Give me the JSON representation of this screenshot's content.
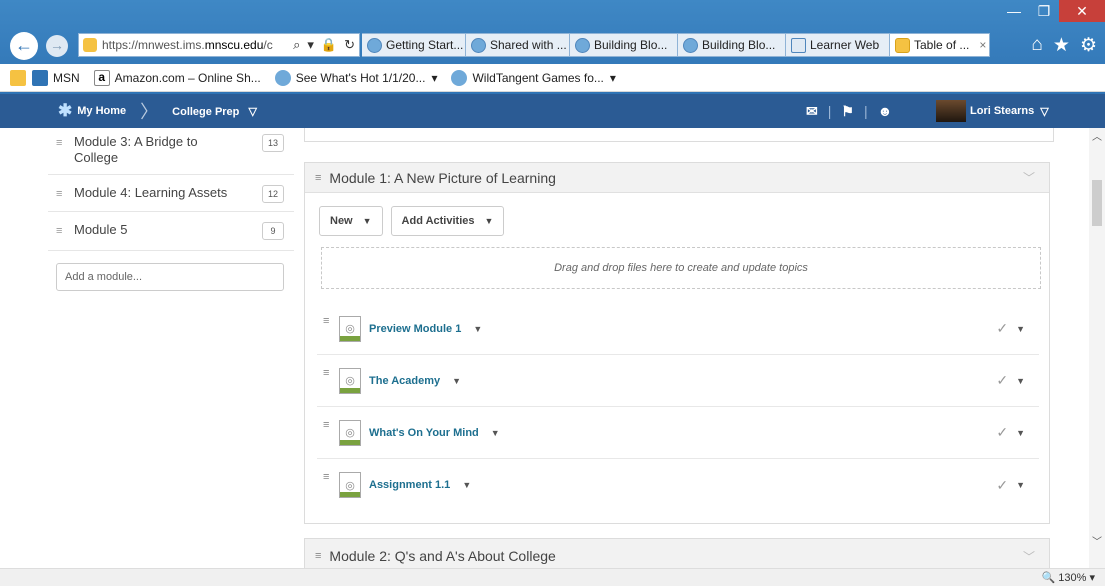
{
  "window_controls": {
    "minimize": "—",
    "restore": "❐",
    "close": "✕"
  },
  "browser": {
    "back_icon": "←",
    "forward_icon": "→",
    "url_prefix": "https://mnwest.ims.",
    "url_domain": "mnscu.edu",
    "url_suffix": "/c",
    "addr_tools": [
      "⌕",
      "▾",
      "🔒",
      "↻"
    ],
    "tabs": [
      {
        "label": "Getting Start...",
        "active": false
      },
      {
        "label": "Shared with ...",
        "active": false
      },
      {
        "label": "Building Blo...",
        "active": false
      },
      {
        "label": "Building Blo...",
        "active": false
      },
      {
        "label": "Learner Web",
        "active": false
      },
      {
        "label": "Table of ...",
        "active": true,
        "close": "×"
      }
    ],
    "right_icons": [
      "⌂",
      "★",
      "⚙"
    ]
  },
  "favorites": [
    {
      "label": "MSN"
    },
    {
      "label": "Amazon.com – Online Sh..."
    },
    {
      "label": "See What's Hot 1/1/20...",
      "dropdown": "▾"
    },
    {
      "label": "WildTangent Games fo...",
      "dropdown": "▾"
    }
  ],
  "appnav": {
    "home_label": "My Home",
    "separator": "〉",
    "course_label": "College Prep",
    "course_caret": "▽",
    "icons": [
      "✉",
      "⚑",
      "☻"
    ],
    "icon_sep": "|",
    "user_name": "Lori Stearns",
    "user_caret": "▽"
  },
  "sidebar": {
    "modules": [
      {
        "grip": "≡",
        "label": "Module 3:  A Bridge to College",
        "count": "13"
      },
      {
        "grip": "≡",
        "label": "Module 4:  Learning Assets",
        "count": "12"
      },
      {
        "grip": "≡",
        "label": "Module 5",
        "count": "9"
      }
    ],
    "add_module_placeholder": "Add a module..."
  },
  "main": {
    "module1": {
      "grip": "≡",
      "title": "Module 1: A New Picture of Learning",
      "chevron": "﹀",
      "new_button": "New",
      "add_activities_button": "Add Activities",
      "caret": "▼",
      "dropzone_text": "Drag and drop files here to create and update topics",
      "topics": [
        {
          "name": "Preview Module 1"
        },
        {
          "name": "The Academy"
        },
        {
          "name": "What's On Your Mind"
        },
        {
          "name": "Assignment 1.1"
        }
      ],
      "topic_check": "✓",
      "topic_caret": "▼",
      "topic_grip": "≡"
    },
    "module2": {
      "grip": "≡",
      "title": "Module 2: Q's and A's About College",
      "chevron": "﹀"
    }
  },
  "scrollbar": {
    "up": "︿",
    "down": "﹀"
  },
  "status": {
    "zoom": "🔍 130%",
    "zoom_caret": "▾"
  }
}
